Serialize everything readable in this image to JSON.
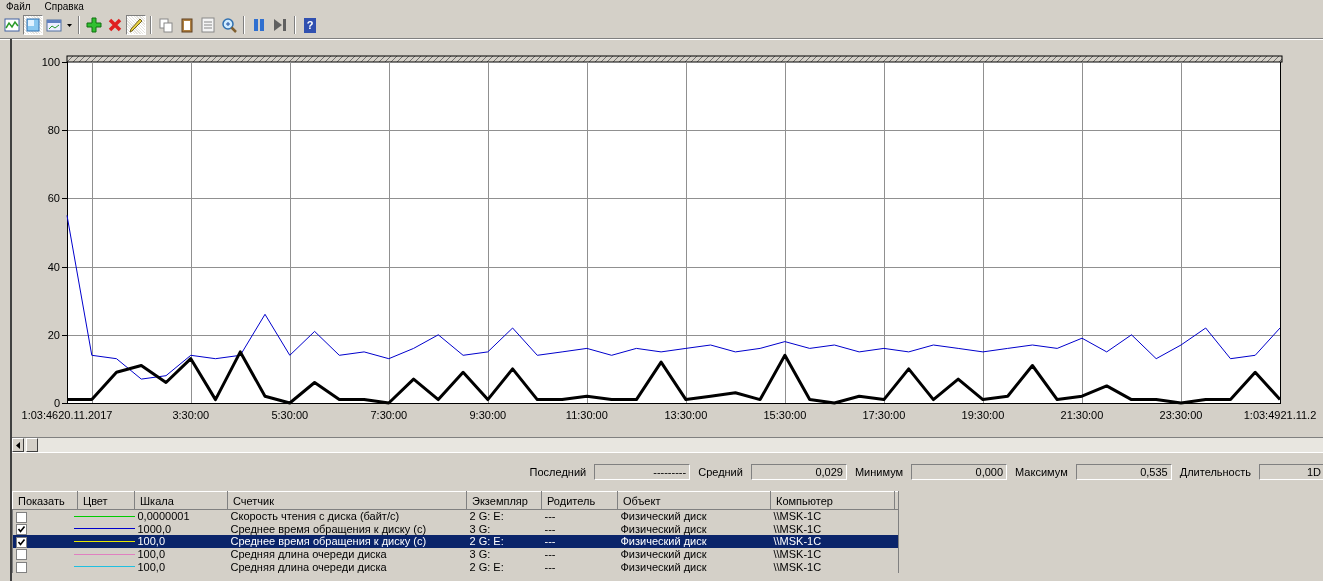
{
  "menu": [
    "Файл",
    "Справка"
  ],
  "toolbar": [
    {
      "kind": "graph",
      "pressed": false
    },
    {
      "kind": "histogram",
      "pressed": true
    },
    {
      "kind": "report",
      "pressed": false
    },
    {
      "kind": "dropdown",
      "pressed": false
    },
    {
      "kind": "sep"
    },
    {
      "kind": "add",
      "pressed": false
    },
    {
      "kind": "delete",
      "pressed": false
    },
    {
      "kind": "highlight",
      "pressed": true
    },
    {
      "kind": "sep"
    },
    {
      "kind": "copy",
      "pressed": false
    },
    {
      "kind": "paste",
      "pressed": false
    },
    {
      "kind": "properties",
      "pressed": false
    },
    {
      "kind": "zoom",
      "pressed": false
    },
    {
      "kind": "sep"
    },
    {
      "kind": "freeze",
      "pressed": false
    },
    {
      "kind": "update",
      "pressed": false
    },
    {
      "kind": "sep"
    },
    {
      "kind": "help",
      "pressed": false,
      "glyph": "?"
    }
  ],
  "chart": {
    "chart_data": {
      "type": "line",
      "grid": true,
      "ylim": [
        0,
        100
      ],
      "yticks": [
        0,
        20,
        40,
        60,
        80,
        100
      ],
      "categories": [
        "1:03:4620.11.2017",
        null,
        null,
        null,
        null,
        "3:30:00",
        null,
        null,
        null,
        "5:30:00",
        null,
        null,
        null,
        "7:30:00",
        null,
        null,
        null,
        "9:30:00",
        null,
        null,
        null,
        "11:30:00",
        null,
        null,
        null,
        "13:30:00",
        null,
        null,
        null,
        "15:30:00",
        null,
        null,
        null,
        "17:30:00",
        null,
        null,
        null,
        "19:30:00",
        null,
        null,
        null,
        "21:30:00",
        null,
        null,
        null,
        "23:30:00",
        null,
        null,
        null,
        "1:03:4921.11.2"
      ],
      "series": [
        {
          "color": "#0000cc",
          "values": [
            55,
            14,
            13,
            7,
            8,
            14,
            13,
            14,
            26,
            14,
            21,
            14,
            15,
            13,
            16,
            20,
            14,
            15,
            22,
            14,
            15,
            16,
            14,
            16,
            15,
            16,
            17,
            15,
            16,
            18,
            16,
            17,
            15,
            16,
            15,
            17,
            16,
            15,
            16,
            17,
            16,
            19,
            15,
            20,
            13,
            17,
            22,
            13,
            14,
            22
          ]
        },
        {
          "color": "#000000",
          "values": [
            1,
            1,
            9,
            11,
            6,
            13,
            1,
            15,
            2,
            0,
            6,
            1,
            1,
            0,
            7,
            1,
            9,
            1,
            10,
            1,
            1,
            2,
            1,
            1,
            12,
            1,
            2,
            3,
            1,
            14,
            1,
            0,
            2,
            1,
            10,
            1,
            7,
            1,
            2,
            11,
            1,
            2,
            5,
            1,
            1,
            0,
            1,
            1,
            9,
            1
          ]
        }
      ]
    }
  },
  "stats": [
    {
      "label": "Последний",
      "value": "---------"
    },
    {
      "label": "Средний",
      "value": "0,029"
    },
    {
      "label": "Минимум",
      "value": "0,000"
    },
    {
      "label": "Максимум",
      "value": "0,535"
    },
    {
      "label": "Длительность",
      "value": "1D"
    }
  ],
  "table": {
    "columns": [
      "Показать",
      "Цвет",
      "Шкала",
      "Счетчик",
      "Экземпляр",
      "Родитель",
      "Объект",
      "Компьютер"
    ],
    "rows": [
      {
        "checked": false,
        "color": "#00cc00",
        "scale": "0,0000001",
        "counter": "Скорость чтения с диска (байт/с)",
        "instance": "2 G: E:",
        "parent": "---",
        "object": "Физический диск",
        "computer": "\\\\MSK-1C",
        "selected": false
      },
      {
        "checked": true,
        "color": "#0000cc",
        "scale": "1000,0",
        "counter": "Среднее время обращения к диску (с)",
        "instance": "3 G:",
        "parent": "---",
        "object": "Физический диск",
        "computer": "\\\\MSK-1C",
        "selected": false
      },
      {
        "checked": true,
        "color": "#e8e800",
        "scale": "100,0",
        "counter": "Среднее время обращения к диску (с)",
        "instance": "2 G: E:",
        "parent": "---",
        "object": "Физический диск",
        "computer": "\\\\MSK-1C",
        "selected": true
      },
      {
        "checked": false,
        "color": "#e080c0",
        "scale": "100,0",
        "counter": "Средняя длина очереди диска",
        "instance": "3 G:",
        "parent": "---",
        "object": "Физический диск",
        "computer": "\\\\MSK-1C",
        "selected": false
      },
      {
        "checked": false,
        "color": "#20c0e0",
        "scale": "100,0",
        "counter": "Средняя длина очереди диска",
        "instance": "2 G: E:",
        "parent": "---",
        "object": "Физический диск",
        "computer": "\\\\MSK-1C",
        "selected": false
      }
    ]
  }
}
